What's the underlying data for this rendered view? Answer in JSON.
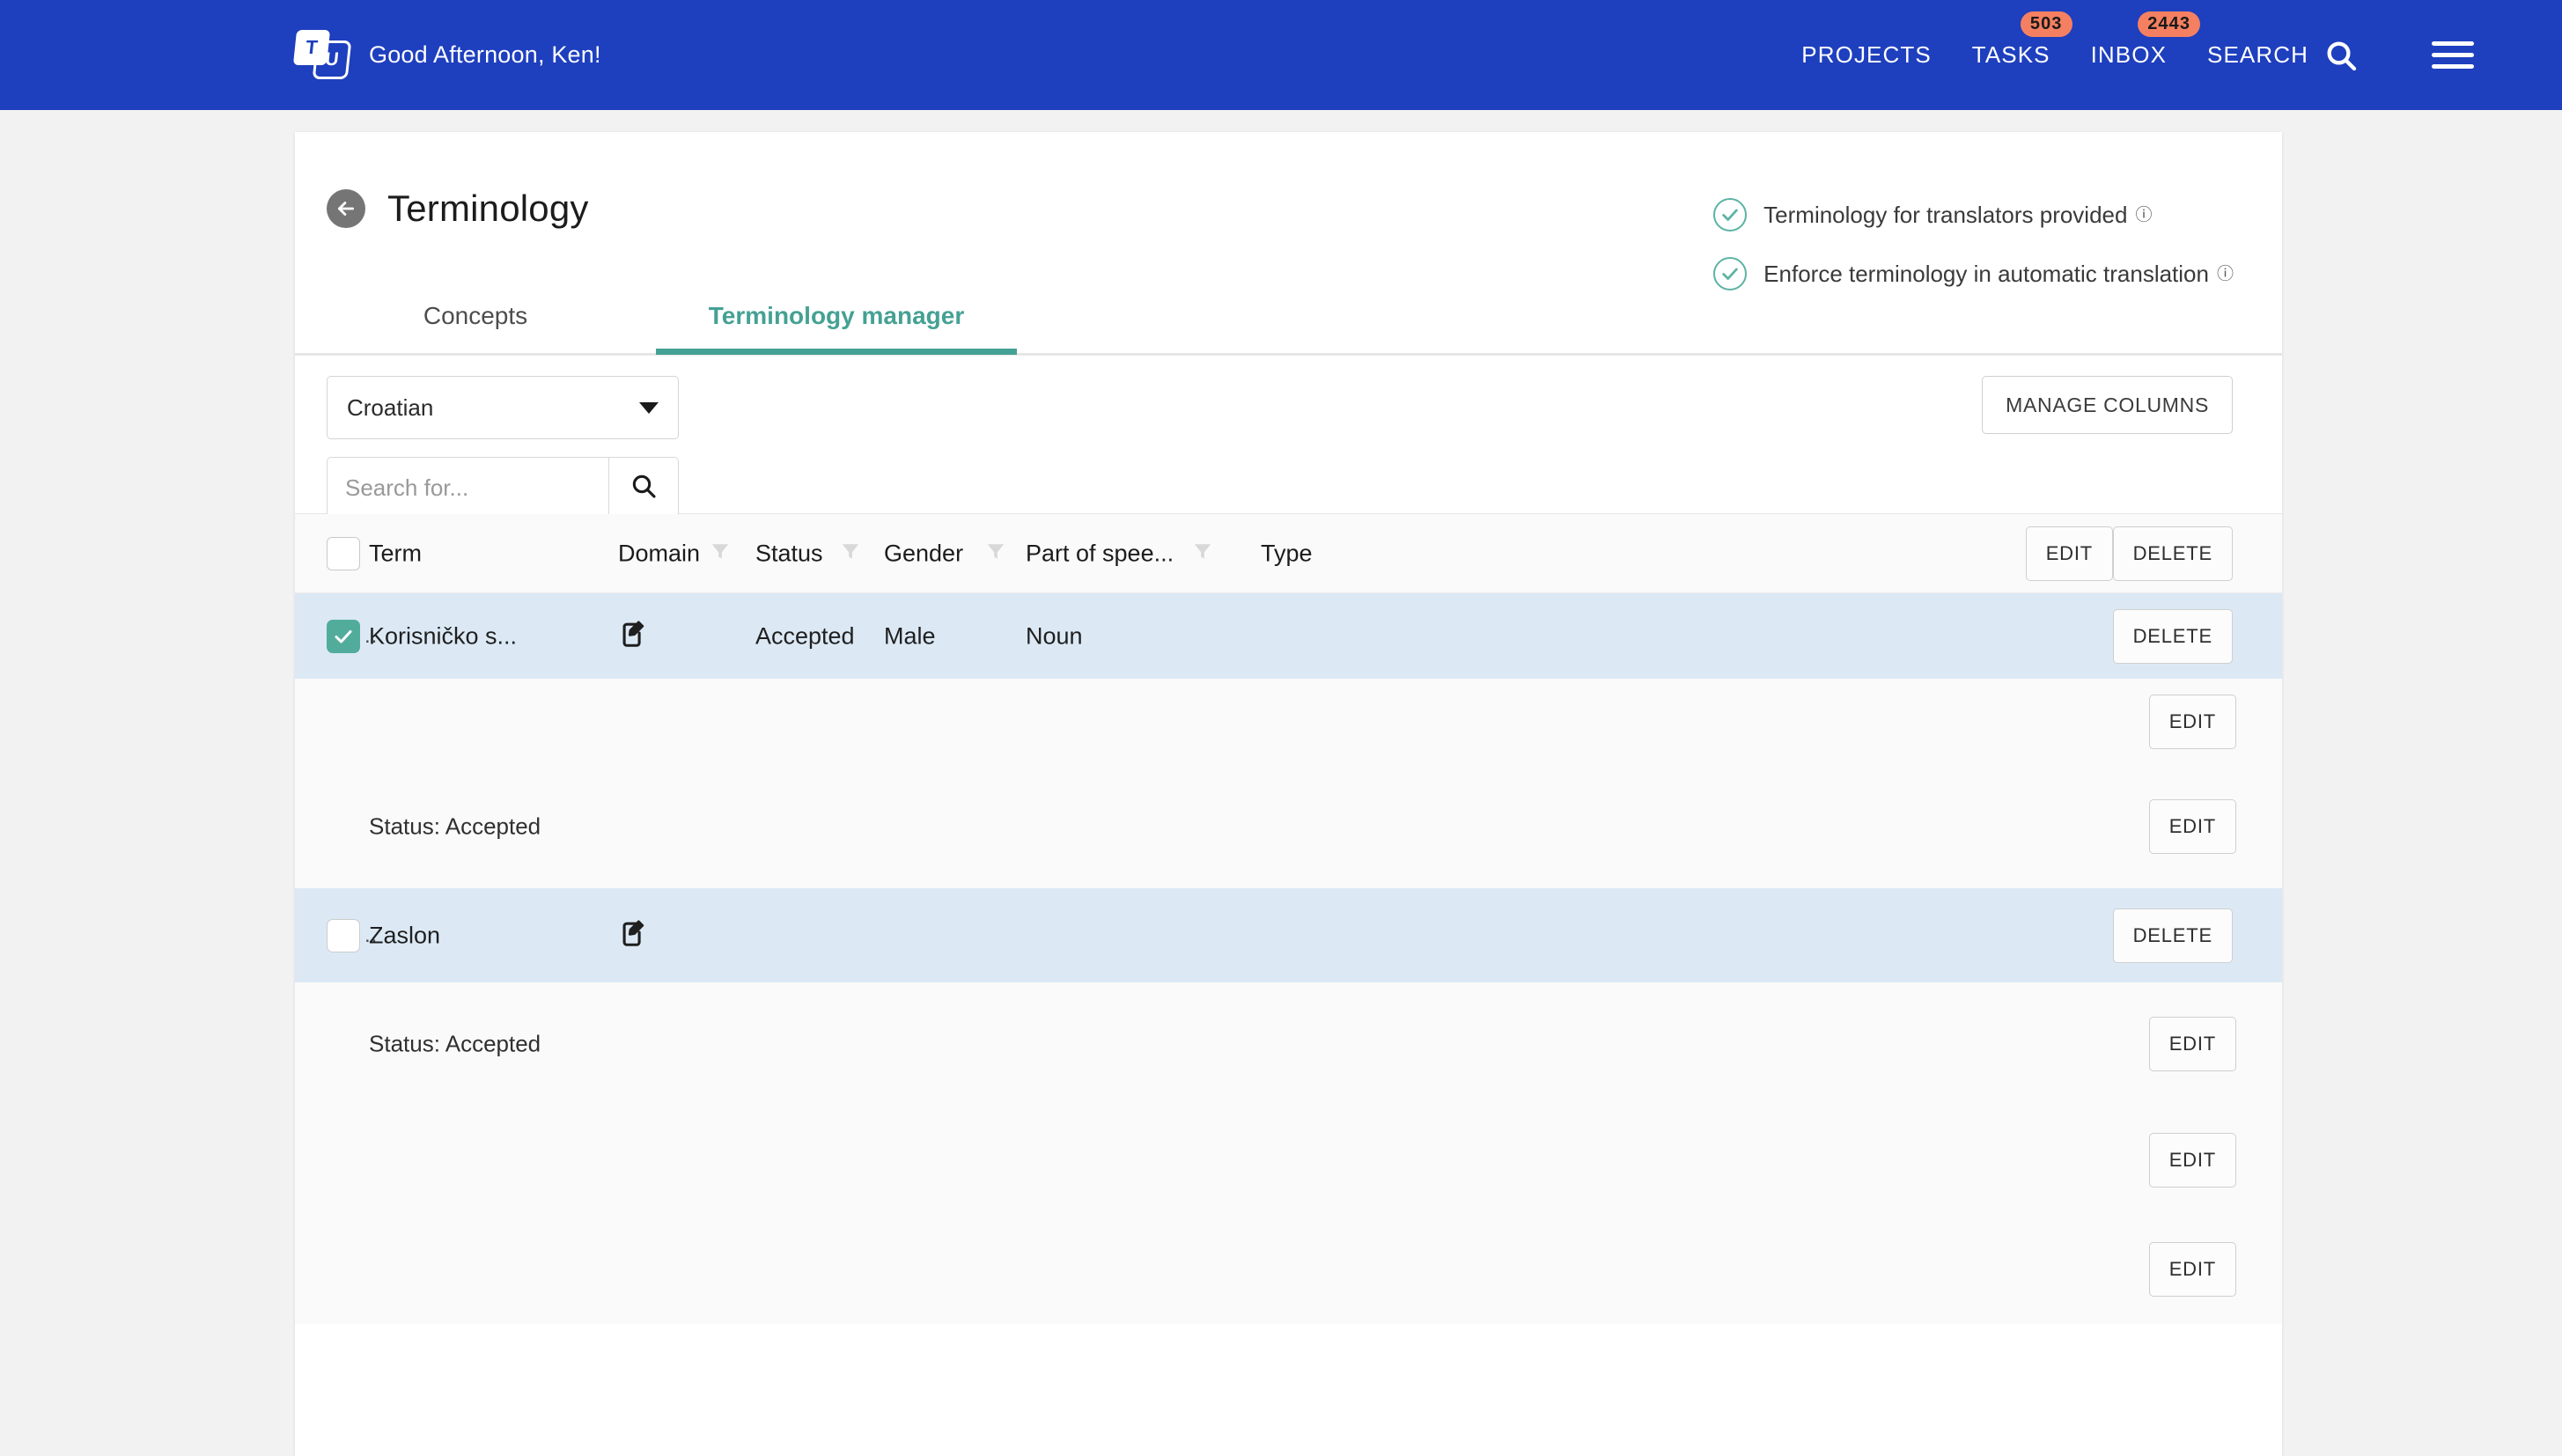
{
  "topbar": {
    "logo_letters": {
      "first": "T",
      "second": "U"
    },
    "greeting": "Good Afternoon, Ken!",
    "nav": [
      {
        "label": "PROJECTS",
        "badge": null,
        "name": "nav-projects"
      },
      {
        "label": "TASKS",
        "badge": "503",
        "name": "nav-tasks"
      },
      {
        "label": "INBOX",
        "badge": "2443",
        "name": "nav-inbox"
      }
    ],
    "search_label": "SEARCH",
    "search_icon": "search-icon",
    "menu_icon": "hamburger-menu-icon",
    "background_color": "#1e3fbe",
    "badge_color": "#f58061"
  },
  "page": {
    "title": "Terminology",
    "back_icon": "back-arrow-icon",
    "tabs": [
      {
        "label": "Concepts",
        "active": false
      },
      {
        "label": "Terminology manager",
        "active": true
      }
    ],
    "accent_color": "#45a194",
    "status_items": [
      {
        "label": "Terminology for translators provided",
        "help": "?",
        "checked": true
      },
      {
        "label": "Enforce terminology in automatic translation",
        "help": "?",
        "checked": true
      }
    ]
  },
  "filterbar": {
    "language_value": "Croatian",
    "language_caret_icon": "chevron-down-icon",
    "search_placeholder": "Search for...",
    "search_value": "",
    "search_icon": "search-icon",
    "manage_columns_label": "MANAGE COLUMNS"
  },
  "table": {
    "headers": [
      {
        "label": "Term",
        "filter": false
      },
      {
        "label": "Domain",
        "filter": true
      },
      {
        "label": "Status",
        "filter": true
      },
      {
        "label": "Gender",
        "filter": true
      },
      {
        "label": "Part of spee...",
        "filter": true
      },
      {
        "label": "Type",
        "filter": false
      }
    ],
    "header_actions": {
      "edit": "EDIT",
      "delete": "DELETE"
    },
    "select_all_checked": false,
    "rows": [
      {
        "type": "",
        "selected": true,
        "checked": true,
        "dots": "..",
        "term": "Korisničko s...",
        "domain": "",
        "edit_icon": "edit-note-icon",
        "status": "Accepted",
        "gender": "Male",
        "part_of_speech": "Noun",
        "action": "DELETE"
      },
      {
        "type": "spacer",
        "action": "EDIT",
        "detail": ""
      },
      {
        "type": "detail",
        "action": "EDIT",
        "detail": "Status: Accepted"
      },
      {
        "type": "",
        "selected": true,
        "checked": false,
        "dots": "..",
        "term": "Zaslon",
        "domain": "",
        "edit_icon": "edit-note-icon",
        "status": "",
        "gender": "",
        "part_of_speech": "",
        "action": "DELETE"
      },
      {
        "type": "detail",
        "action": "EDIT",
        "detail": "Status: Accepted"
      },
      {
        "type": "spacer",
        "action": "EDIT",
        "detail": ""
      },
      {
        "type": "spacer",
        "action": "EDIT",
        "detail": ""
      }
    ]
  }
}
